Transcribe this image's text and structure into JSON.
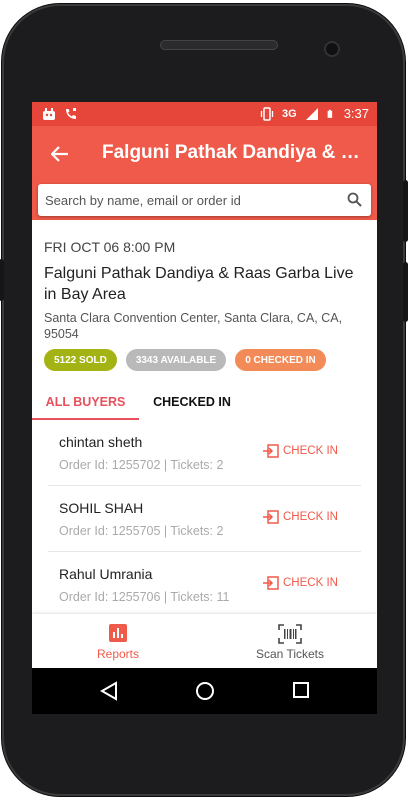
{
  "status_bar": {
    "network": "3G",
    "time": "3:37"
  },
  "app_bar": {
    "title": "Falguni Pathak Dandiya & Raas Garba Live in Bay Area"
  },
  "search": {
    "placeholder": "Search by name, email or order id"
  },
  "event": {
    "date": "FRI OCT 06 8:00 PM",
    "title": "Falguni Pathak Dandiya & Raas Garba Live in Bay Area",
    "venue": "Santa Clara Convention Center, Santa Clara, CA, CA, 95054",
    "badges": [
      {
        "label": "5122 SOLD",
        "color": "#a4b314"
      },
      {
        "label": "3343 AVAILABLE",
        "color": "#b9b9b9"
      },
      {
        "label": "0 CHECKED IN",
        "color": "#f38b58"
      }
    ]
  },
  "tabs": [
    {
      "label": "ALL BUYERS"
    },
    {
      "label": "CHECKED IN"
    }
  ],
  "buyers": [
    {
      "name": "chintan sheth",
      "details": "Order Id: 1255702 | Tickets: 2",
      "action": "CHECK IN"
    },
    {
      "name": "SOHIL SHAH",
      "details": "Order Id: 1255705 | Tickets: 2",
      "action": "CHECK IN"
    },
    {
      "name": "Rahul Umrania",
      "details": "Order Id: 1255706 | Tickets: 11",
      "action": "CHECK IN"
    }
  ],
  "bottom_nav": [
    {
      "label": "Reports",
      "icon": "bar-chart-icon"
    },
    {
      "label": "Scan Tickets",
      "icon": "barcode-scan-icon"
    }
  ],
  "colors": {
    "accent": "#f05a4a",
    "status_bar": "#e6463a",
    "tab_active": "#e8505b"
  }
}
